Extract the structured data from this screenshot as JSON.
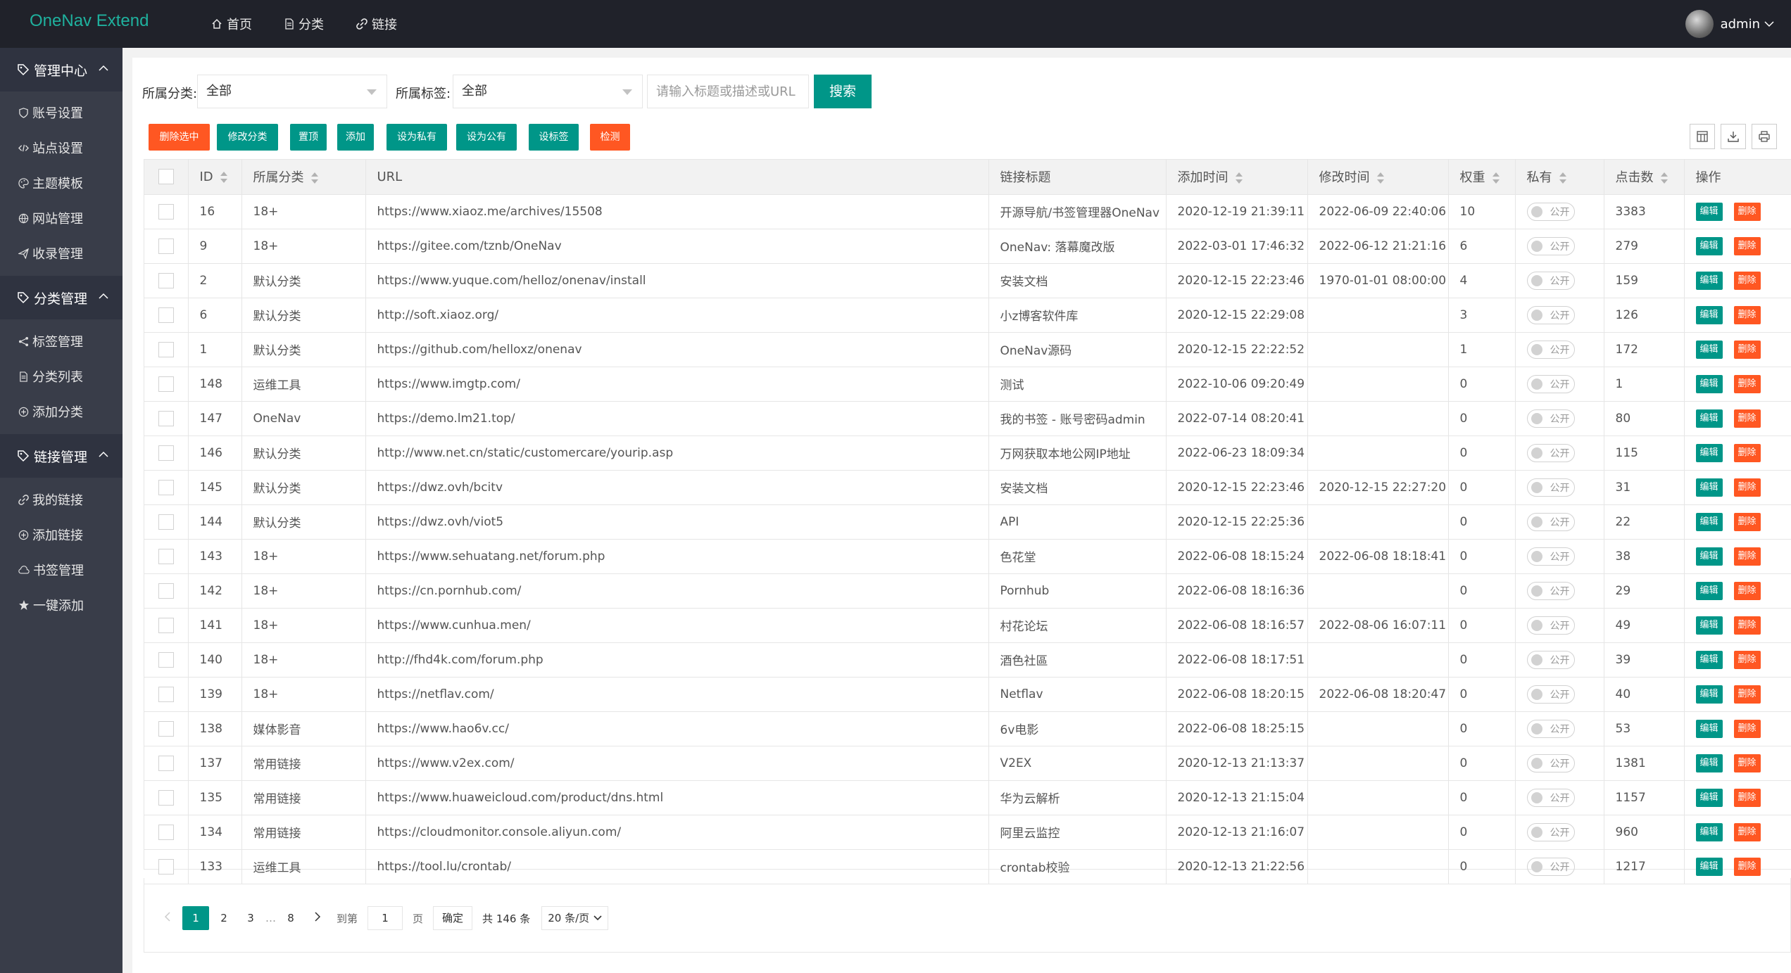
{
  "header": {
    "app_title": "OneNav Extend",
    "nav": [
      {
        "label": "首页",
        "icon": "home-icon"
      },
      {
        "label": "分类",
        "icon": "document-icon"
      },
      {
        "label": "链接",
        "icon": "link-icon"
      }
    ],
    "user_name": "admin"
  },
  "sidebar": {
    "groups": [
      {
        "label": "管理中心",
        "icon": "tag-icon",
        "items": [
          {
            "label": "账号设置",
            "icon": "shield-icon"
          },
          {
            "label": "站点设置",
            "icon": "code-icon"
          },
          {
            "label": "主题模板",
            "icon": "palette-icon"
          },
          {
            "label": "网站管理",
            "icon": "globe-icon"
          },
          {
            "label": "收录管理",
            "icon": "send-icon"
          }
        ]
      },
      {
        "label": "分类管理",
        "icon": "tag-icon",
        "items": [
          {
            "label": "标签管理",
            "icon": "share-icon"
          },
          {
            "label": "分类列表",
            "icon": "list-icon"
          },
          {
            "label": "添加分类",
            "icon": "add-circle-icon"
          }
        ]
      },
      {
        "label": "链接管理",
        "icon": "tag-icon",
        "items": [
          {
            "label": "我的链接",
            "icon": "link-icon"
          },
          {
            "label": "添加链接",
            "icon": "add-circle-icon"
          },
          {
            "label": "书签管理",
            "icon": "cloud-icon"
          },
          {
            "label": "一键添加",
            "icon": "star-icon"
          }
        ]
      }
    ]
  },
  "search": {
    "category_label": "所属分类:",
    "category_value": "全部",
    "tag_label": "所属标签:",
    "tag_value": "全部",
    "keyword_placeholder": "请输入标题或描述或URL",
    "search_button": "搜索"
  },
  "toolbar": {
    "delete_selected": "删除选中",
    "edit_category": "修改分类",
    "pin_top": "置顶",
    "add": "添加",
    "set_private": "设为私有",
    "set_public": "设为公有",
    "set_tag": "设标签",
    "check": "检测"
  },
  "table": {
    "columns": [
      "ID",
      "所属分类",
      "URL",
      "链接标题",
      "添加时间",
      "修改时间",
      "权重",
      "私有",
      "点击数",
      "操作"
    ],
    "switch_label": "公开",
    "edit_label": "编辑",
    "delete_label": "删除",
    "rows": [
      {
        "id": "16",
        "category": "18+",
        "url": "https://www.xiaoz.me/archives/15508",
        "title": "开源导航/书签管理器OneNav",
        "added": "2020-12-19 21:39:11",
        "modified": "2022-06-09 22:40:06",
        "weight": "10",
        "clicks": "3383"
      },
      {
        "id": "9",
        "category": "18+",
        "url": "https://gitee.com/tznb/OneNav",
        "title": "OneNav: 落幕魔改版",
        "added": "2022-03-01 17:46:32",
        "modified": "2022-06-12 21:21:16",
        "weight": "6",
        "clicks": "279"
      },
      {
        "id": "2",
        "category": "默认分类",
        "url": "https://www.yuque.com/helloz/onenav/install",
        "title": "安装文档",
        "added": "2020-12-15 22:23:46",
        "modified": "1970-01-01 08:00:00",
        "weight": "4",
        "clicks": "159"
      },
      {
        "id": "6",
        "category": "默认分类",
        "url": "http://soft.xiaoz.org/",
        "title": "小z博客软件库",
        "added": "2020-12-15 22:29:08",
        "modified": "",
        "weight": "3",
        "clicks": "126"
      },
      {
        "id": "1",
        "category": "默认分类",
        "url": "https://github.com/helloxz/onenav",
        "title": "OneNav源码",
        "added": "2020-12-15 22:22:52",
        "modified": "",
        "weight": "1",
        "clicks": "172"
      },
      {
        "id": "148",
        "category": "运维工具",
        "url": "https://www.imgtp.com/",
        "title": "测试",
        "added": "2022-10-06 09:20:49",
        "modified": "",
        "weight": "0",
        "clicks": "1"
      },
      {
        "id": "147",
        "category": "OneNav",
        "url": "https://demo.lm21.top/",
        "title": "我的书签 - 账号密码admin",
        "added": "2022-07-14 08:20:41",
        "modified": "",
        "weight": "0",
        "clicks": "80"
      },
      {
        "id": "146",
        "category": "默认分类",
        "url": "http://www.net.cn/static/customercare/yourip.asp",
        "title": "万网获取本地公网IP地址",
        "added": "2022-06-23 18:09:34",
        "modified": "",
        "weight": "0",
        "clicks": "115"
      },
      {
        "id": "145",
        "category": "默认分类",
        "url": "https://dwz.ovh/bcitv",
        "title": "安装文档",
        "added": "2020-12-15 22:23:46",
        "modified": "2020-12-15 22:27:20",
        "weight": "0",
        "clicks": "31"
      },
      {
        "id": "144",
        "category": "默认分类",
        "url": "https://dwz.ovh/viot5",
        "title": "API",
        "added": "2020-12-15 22:25:36",
        "modified": "",
        "weight": "0",
        "clicks": "22"
      },
      {
        "id": "143",
        "category": "18+",
        "url": "https://www.sehuatang.net/forum.php",
        "title": "色花堂",
        "added": "2022-06-08 18:15:24",
        "modified": "2022-06-08 18:18:41",
        "weight": "0",
        "clicks": "38"
      },
      {
        "id": "142",
        "category": "18+",
        "url": "https://cn.pornhub.com/",
        "title": "Pornhub",
        "added": "2022-06-08 18:16:36",
        "modified": "",
        "weight": "0",
        "clicks": "29"
      },
      {
        "id": "141",
        "category": "18+",
        "url": "https://www.cunhua.men/",
        "title": "村花论坛",
        "added": "2022-06-08 18:16:57",
        "modified": "2022-08-06 16:07:11",
        "weight": "0",
        "clicks": "49"
      },
      {
        "id": "140",
        "category": "18+",
        "url": "http://fhd4k.com/forum.php",
        "title": "酒色社區",
        "added": "2022-06-08 18:17:51",
        "modified": "",
        "weight": "0",
        "clicks": "39"
      },
      {
        "id": "139",
        "category": "18+",
        "url": "https://netflav.com/",
        "title": "Netflav",
        "added": "2022-06-08 18:20:15",
        "modified": "2022-06-08 18:20:47",
        "weight": "0",
        "clicks": "40"
      },
      {
        "id": "138",
        "category": "媒体影音",
        "url": "https://www.hao6v.cc/",
        "title": "6v电影",
        "added": "2022-06-08 18:25:15",
        "modified": "",
        "weight": "0",
        "clicks": "53"
      },
      {
        "id": "137",
        "category": "常用链接",
        "url": "https://www.v2ex.com/",
        "title": "V2EX",
        "added": "2020-12-13 21:13:37",
        "modified": "",
        "weight": "0",
        "clicks": "1381"
      },
      {
        "id": "135",
        "category": "常用链接",
        "url": "https://www.huaweicloud.com/product/dns.html",
        "title": "华为云解析",
        "added": "2020-12-13 21:15:04",
        "modified": "",
        "weight": "0",
        "clicks": "1157"
      },
      {
        "id": "134",
        "category": "常用链接",
        "url": "https://cloudmonitor.console.aliyun.com/",
        "title": "阿里云监控",
        "added": "2020-12-13 21:16:07",
        "modified": "",
        "weight": "0",
        "clicks": "960"
      },
      {
        "id": "133",
        "category": "运维工具",
        "url": "https://tool.lu/crontab/",
        "title": "crontab校验",
        "added": "2020-12-13 21:22:56",
        "modified": "",
        "weight": "0",
        "clicks": "1217"
      }
    ]
  },
  "pager": {
    "pages": [
      "1",
      "2",
      "3",
      "…",
      "8"
    ],
    "current": "1",
    "goto_label": "到第",
    "goto_value": "1",
    "page_unit": "页",
    "confirm": "确定",
    "total": "共 146 条",
    "page_size": "20 条/页"
  },
  "colors": {
    "brand": "#1fb19e",
    "primary": "#009688",
    "danger": "#ff5722",
    "header_bg": "#20222a",
    "sidebar_bg": "#393d49"
  }
}
